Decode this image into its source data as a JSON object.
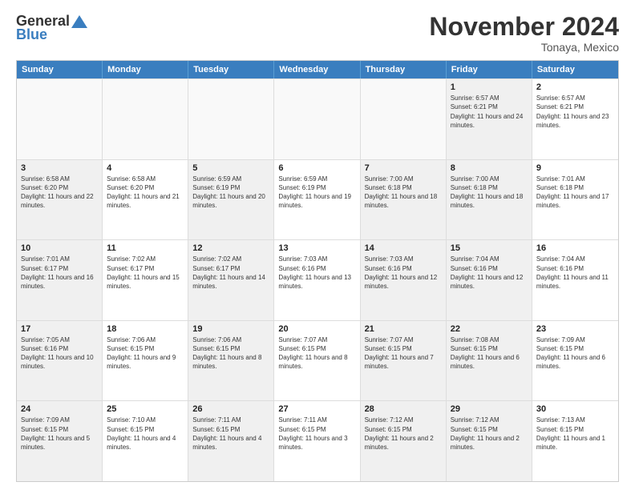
{
  "header": {
    "logo_general": "General",
    "logo_blue": "Blue",
    "month_title": "November 2024",
    "location": "Tonaya, Mexico"
  },
  "days_of_week": [
    "Sunday",
    "Monday",
    "Tuesday",
    "Wednesday",
    "Thursday",
    "Friday",
    "Saturday"
  ],
  "weeks": [
    [
      {
        "day": "",
        "empty": true
      },
      {
        "day": "",
        "empty": true
      },
      {
        "day": "",
        "empty": true
      },
      {
        "day": "",
        "empty": true
      },
      {
        "day": "",
        "empty": true
      },
      {
        "day": "1",
        "sunrise": "Sunrise: 6:57 AM",
        "sunset": "Sunset: 6:21 PM",
        "daylight": "Daylight: 11 hours and 24 minutes.",
        "shaded": true
      },
      {
        "day": "2",
        "sunrise": "Sunrise: 6:57 AM",
        "sunset": "Sunset: 6:21 PM",
        "daylight": "Daylight: 11 hours and 23 minutes.",
        "shaded": false
      }
    ],
    [
      {
        "day": "3",
        "sunrise": "Sunrise: 6:58 AM",
        "sunset": "Sunset: 6:20 PM",
        "daylight": "Daylight: 11 hours and 22 minutes.",
        "shaded": true
      },
      {
        "day": "4",
        "sunrise": "Sunrise: 6:58 AM",
        "sunset": "Sunset: 6:20 PM",
        "daylight": "Daylight: 11 hours and 21 minutes.",
        "shaded": false
      },
      {
        "day": "5",
        "sunrise": "Sunrise: 6:59 AM",
        "sunset": "Sunset: 6:19 PM",
        "daylight": "Daylight: 11 hours and 20 minutes.",
        "shaded": true
      },
      {
        "day": "6",
        "sunrise": "Sunrise: 6:59 AM",
        "sunset": "Sunset: 6:19 PM",
        "daylight": "Daylight: 11 hours and 19 minutes.",
        "shaded": false
      },
      {
        "day": "7",
        "sunrise": "Sunrise: 7:00 AM",
        "sunset": "Sunset: 6:18 PM",
        "daylight": "Daylight: 11 hours and 18 minutes.",
        "shaded": true
      },
      {
        "day": "8",
        "sunrise": "Sunrise: 7:00 AM",
        "sunset": "Sunset: 6:18 PM",
        "daylight": "Daylight: 11 hours and 18 minutes.",
        "shaded": true
      },
      {
        "day": "9",
        "sunrise": "Sunrise: 7:01 AM",
        "sunset": "Sunset: 6:18 PM",
        "daylight": "Daylight: 11 hours and 17 minutes.",
        "shaded": false
      }
    ],
    [
      {
        "day": "10",
        "sunrise": "Sunrise: 7:01 AM",
        "sunset": "Sunset: 6:17 PM",
        "daylight": "Daylight: 11 hours and 16 minutes.",
        "shaded": true
      },
      {
        "day": "11",
        "sunrise": "Sunrise: 7:02 AM",
        "sunset": "Sunset: 6:17 PM",
        "daylight": "Daylight: 11 hours and 15 minutes.",
        "shaded": false
      },
      {
        "day": "12",
        "sunrise": "Sunrise: 7:02 AM",
        "sunset": "Sunset: 6:17 PM",
        "daylight": "Daylight: 11 hours and 14 minutes.",
        "shaded": true
      },
      {
        "day": "13",
        "sunrise": "Sunrise: 7:03 AM",
        "sunset": "Sunset: 6:16 PM",
        "daylight": "Daylight: 11 hours and 13 minutes.",
        "shaded": false
      },
      {
        "day": "14",
        "sunrise": "Sunrise: 7:03 AM",
        "sunset": "Sunset: 6:16 PM",
        "daylight": "Daylight: 11 hours and 12 minutes.",
        "shaded": true
      },
      {
        "day": "15",
        "sunrise": "Sunrise: 7:04 AM",
        "sunset": "Sunset: 6:16 PM",
        "daylight": "Daylight: 11 hours and 12 minutes.",
        "shaded": true
      },
      {
        "day": "16",
        "sunrise": "Sunrise: 7:04 AM",
        "sunset": "Sunset: 6:16 PM",
        "daylight": "Daylight: 11 hours and 11 minutes.",
        "shaded": false
      }
    ],
    [
      {
        "day": "17",
        "sunrise": "Sunrise: 7:05 AM",
        "sunset": "Sunset: 6:16 PM",
        "daylight": "Daylight: 11 hours and 10 minutes.",
        "shaded": true
      },
      {
        "day": "18",
        "sunrise": "Sunrise: 7:06 AM",
        "sunset": "Sunset: 6:15 PM",
        "daylight": "Daylight: 11 hours and 9 minutes.",
        "shaded": false
      },
      {
        "day": "19",
        "sunrise": "Sunrise: 7:06 AM",
        "sunset": "Sunset: 6:15 PM",
        "daylight": "Daylight: 11 hours and 8 minutes.",
        "shaded": true
      },
      {
        "day": "20",
        "sunrise": "Sunrise: 7:07 AM",
        "sunset": "Sunset: 6:15 PM",
        "daylight": "Daylight: 11 hours and 8 minutes.",
        "shaded": false
      },
      {
        "day": "21",
        "sunrise": "Sunrise: 7:07 AM",
        "sunset": "Sunset: 6:15 PM",
        "daylight": "Daylight: 11 hours and 7 minutes.",
        "shaded": true
      },
      {
        "day": "22",
        "sunrise": "Sunrise: 7:08 AM",
        "sunset": "Sunset: 6:15 PM",
        "daylight": "Daylight: 11 hours and 6 minutes.",
        "shaded": true
      },
      {
        "day": "23",
        "sunrise": "Sunrise: 7:09 AM",
        "sunset": "Sunset: 6:15 PM",
        "daylight": "Daylight: 11 hours and 6 minutes.",
        "shaded": false
      }
    ],
    [
      {
        "day": "24",
        "sunrise": "Sunrise: 7:09 AM",
        "sunset": "Sunset: 6:15 PM",
        "daylight": "Daylight: 11 hours and 5 minutes.",
        "shaded": true
      },
      {
        "day": "25",
        "sunrise": "Sunrise: 7:10 AM",
        "sunset": "Sunset: 6:15 PM",
        "daylight": "Daylight: 11 hours and 4 minutes.",
        "shaded": false
      },
      {
        "day": "26",
        "sunrise": "Sunrise: 7:11 AM",
        "sunset": "Sunset: 6:15 PM",
        "daylight": "Daylight: 11 hours and 4 minutes.",
        "shaded": true
      },
      {
        "day": "27",
        "sunrise": "Sunrise: 7:11 AM",
        "sunset": "Sunset: 6:15 PM",
        "daylight": "Daylight: 11 hours and 3 minutes.",
        "shaded": false
      },
      {
        "day": "28",
        "sunrise": "Sunrise: 7:12 AM",
        "sunset": "Sunset: 6:15 PM",
        "daylight": "Daylight: 11 hours and 2 minutes.",
        "shaded": true
      },
      {
        "day": "29",
        "sunrise": "Sunrise: 7:12 AM",
        "sunset": "Sunset: 6:15 PM",
        "daylight": "Daylight: 11 hours and 2 minutes.",
        "shaded": true
      },
      {
        "day": "30",
        "sunrise": "Sunrise: 7:13 AM",
        "sunset": "Sunset: 6:15 PM",
        "daylight": "Daylight: 11 hours and 1 minute.",
        "shaded": false
      }
    ]
  ]
}
